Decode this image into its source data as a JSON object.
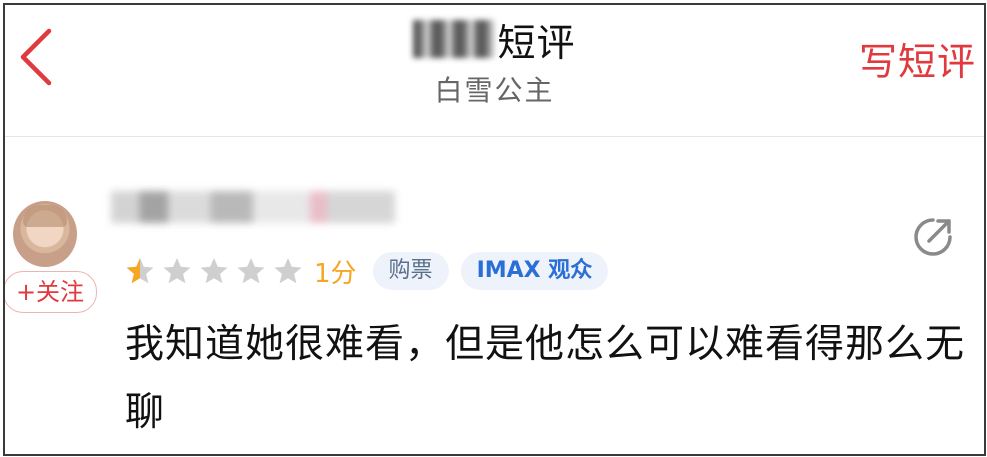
{
  "header": {
    "back_icon": "chevron-left-icon",
    "title": "短评",
    "subtitle": "白雪公主",
    "write_label": "写短评",
    "accent_color": "#e0393e"
  },
  "review": {
    "avatar_icon": "avatar",
    "follow_label": "+关注",
    "rating": {
      "stars_total": 5,
      "stars_filled": 0.5,
      "star_active_color": "#f5a623",
      "star_inactive_color": "#cfcfcf",
      "score_label": "1分"
    },
    "tags": {
      "ticket": "购票",
      "audience": "IMAX 观众"
    },
    "share_icon": "share-icon",
    "text": "我知道她很难看，但是他怎么可以难看得那么无聊"
  }
}
